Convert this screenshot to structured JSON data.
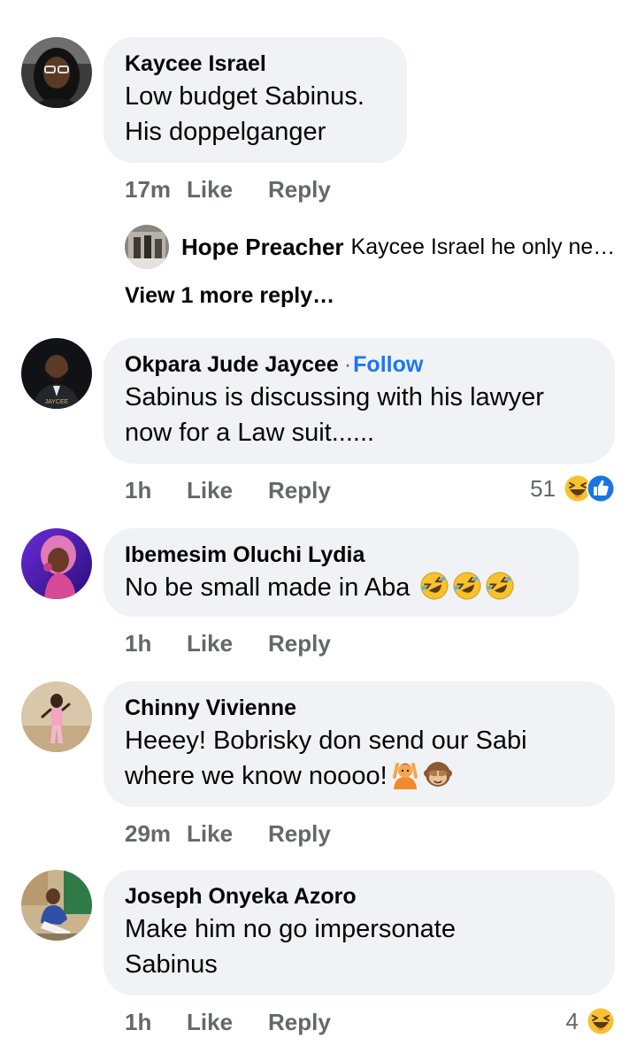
{
  "comments": [
    {
      "name": "Kaycee Israel",
      "lines": [
        "Low budget Sabinus.",
        "His doppelganger"
      ],
      "time": "17m",
      "like": "Like",
      "reply": "Reply"
    },
    {
      "name": "Okpara Jude Jaycee",
      "follow": "Follow",
      "lines": [
        "Sabinus is discussing with his lawyer",
        "now for a Law suit......"
      ],
      "avatar_caption": "JAYCEE",
      "time": "1h",
      "like": "Like",
      "reply": "Reply",
      "reaction_count": "51",
      "reaction_icons": [
        "haha-icon",
        "like-icon"
      ]
    },
    {
      "name": "Ibemesim Oluchi Lydia",
      "lines": [
        "No be small made in Aba"
      ],
      "emojis": [
        "rolling-laughing-emoji",
        "rolling-laughing-emoji",
        "rolling-laughing-emoji"
      ],
      "time": "1h",
      "like": "Like",
      "reply": "Reply"
    },
    {
      "name": "Chinny Vivienne",
      "lines": [
        "Heeey! Bobrisky don send our Sabi",
        "where we know noooo!"
      ],
      "emojis": [
        "person-raising-hands-emoji",
        "see-no-evil-monkey-emoji"
      ],
      "time": "29m",
      "like": "Like",
      "reply": "Reply"
    },
    {
      "name": "Joseph Onyeka Azoro",
      "lines": [
        "Make him no go impersonate",
        "Sabinus"
      ],
      "time": "1h",
      "like": "Like",
      "reply": "Reply",
      "reaction_count": "4",
      "reaction_icons": [
        "haha-icon"
      ]
    }
  ],
  "reply_preview": {
    "name": "Hope Preacher",
    "text": "Kaycee Israel he only ne…"
  },
  "view_more": "View 1 more reply…",
  "colors": {
    "bubble": "#f0f2f5",
    "secondary_text": "#65676b",
    "follow": "#1877f2",
    "primary_text": "#050505"
  }
}
